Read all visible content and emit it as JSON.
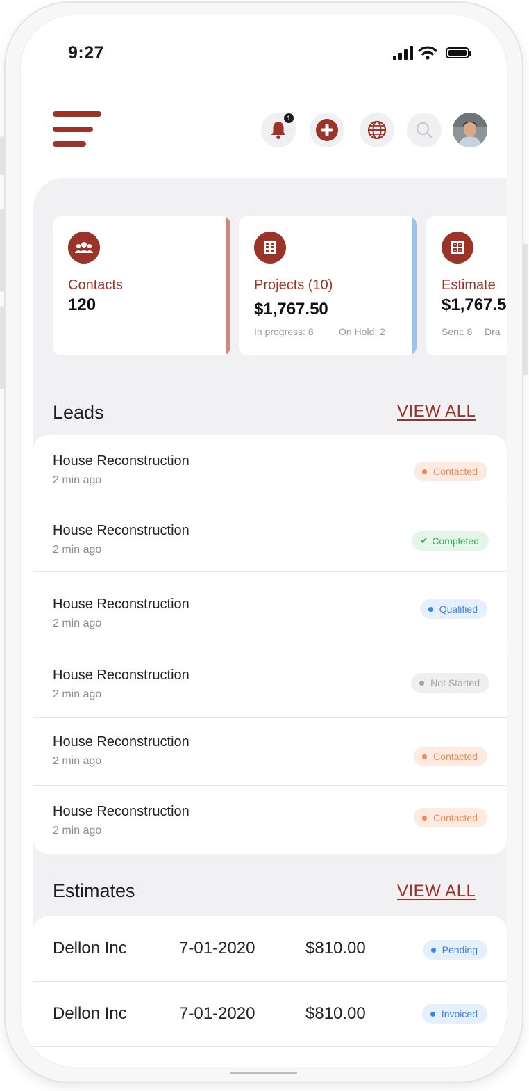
{
  "status_bar": {
    "time": "9:27"
  },
  "header": {
    "notification_count": "1",
    "icons": [
      "menu-icon",
      "bell-icon",
      "add-icon",
      "globe-icon",
      "search-icon",
      "avatar"
    ]
  },
  "summary_cards": [
    {
      "label": "Contacts",
      "value": "120",
      "sub": "",
      "icon": "people-icon",
      "accent_color": "#c98a86"
    },
    {
      "label": "Projects (10)",
      "value": "$1,767.50",
      "sub_left": "In progress: 8",
      "sub_right": "On Hold: 2",
      "icon": "grid-icon",
      "accent_color": "#9dc3ea"
    },
    {
      "label": "Estimate",
      "value": "$1,767.5",
      "sub_left": "Sent: 8",
      "sub_right": "Dra",
      "icon": "calculator-icon",
      "accent_color": "#9a3328"
    }
  ],
  "leads": {
    "title": "Leads",
    "view_all": "VIEW ALL",
    "items": [
      {
        "title": "House Reconstruction",
        "time": "2 min ago",
        "status": "Contacted",
        "status_kind": "orange"
      },
      {
        "title": "House Reconstruction",
        "time": "2 min ago",
        "status": "Completed",
        "status_kind": "green"
      },
      {
        "title": "House Reconstruction",
        "time": "2 min ago",
        "status": "Qualified",
        "status_kind": "blue"
      },
      {
        "title": "House Reconstruction",
        "time": "2 min ago",
        "status": "Not Started",
        "status_kind": "gray"
      },
      {
        "title": "House Reconstruction",
        "time": "2 min ago",
        "status": "Contacted",
        "status_kind": "orange"
      },
      {
        "title": "House Reconstruction",
        "time": "2 min ago",
        "status": "Contacted",
        "status_kind": "orange"
      }
    ]
  },
  "estimates": {
    "title": "Estimates",
    "view_all": "VIEW ALL",
    "items": [
      {
        "client": "Dellon Inc",
        "date": "7-01-2020",
        "amount": "$810.00",
        "status": "Pending",
        "status_kind": "blue"
      },
      {
        "client": "Dellon Inc",
        "date": "7-01-2020",
        "amount": "$810.00",
        "status": "Invoiced",
        "status_kind": "blue"
      }
    ]
  },
  "colors": {
    "brand": "#9a3328",
    "orange_bg": "#fdebe1",
    "orange_fg": "#f08a55",
    "green_bg": "#e5f6e8",
    "green_fg": "#3aa85a",
    "blue_bg": "#e6f0fd",
    "blue_fg": "#3a86e0",
    "gray_bg": "#efefef",
    "gray_fg": "#a3a3a3"
  }
}
